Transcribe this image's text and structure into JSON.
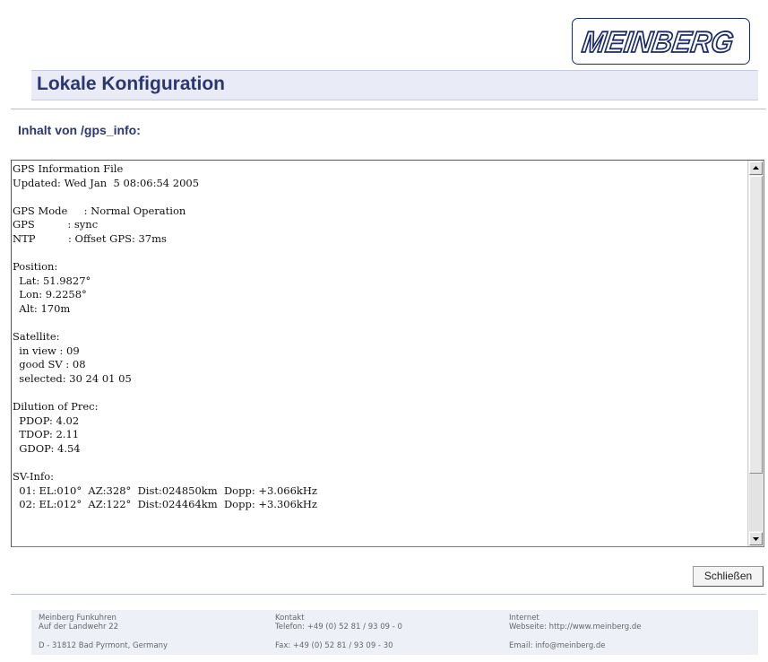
{
  "logo": {
    "text": "MEINBERG"
  },
  "page_title": "Lokale Konfiguration",
  "section_heading": "Inhalt von /gps_info:",
  "file_content": "GPS Information File\nUpdated: Wed Jan  5 08:06:54 2005\n\nGPS Mode     : Normal Operation\nGPS          : sync\nNTP          : Offset GPS: 37ms\n\nPosition:\n  Lat: 51.9827°\n  Lon: 9.2258°\n  Alt: 170m\n\nSatellite:\n  in view : 09\n  good SV : 08\n  selected: 30 24 01 05\n\nDilution of Prec:\n  PDOP: 4.02\n  TDOP: 2.11\n  GDOP: 4.54\n\nSV-Info:\n  01: EL:010°  AZ:328°  Dist:024850km  Dopp: +3.066kHz\n  02: EL:012°  AZ:122°  Dist:024464km  Dopp: +3.306kHz",
  "close_button": "Schließen",
  "footer": {
    "company": {
      "name": "Meinberg Funkuhren",
      "street": "Auf der Landwehr 22",
      "city": "D - 31812 Bad Pyrmont, Germany"
    },
    "contact": {
      "heading": "Kontakt",
      "phone": "Telefon: +49 (0) 52 81 / 93 09 - 0",
      "fax": "Fax: +49 (0) 52 81 / 93 09 - 30"
    },
    "internet": {
      "heading": "Internet",
      "website": "Webseite: http://www.meinberg.de",
      "email": "Email: info@meinberg.de"
    }
  },
  "colors": {
    "brand": "#1b2a6b",
    "title_text": "#2a3773",
    "title_band": "#e9ebf6",
    "footer_bg": "#eef0f8"
  },
  "icons": {
    "scroll_up": "arrow-up-icon",
    "scroll_down": "arrow-down-icon"
  }
}
